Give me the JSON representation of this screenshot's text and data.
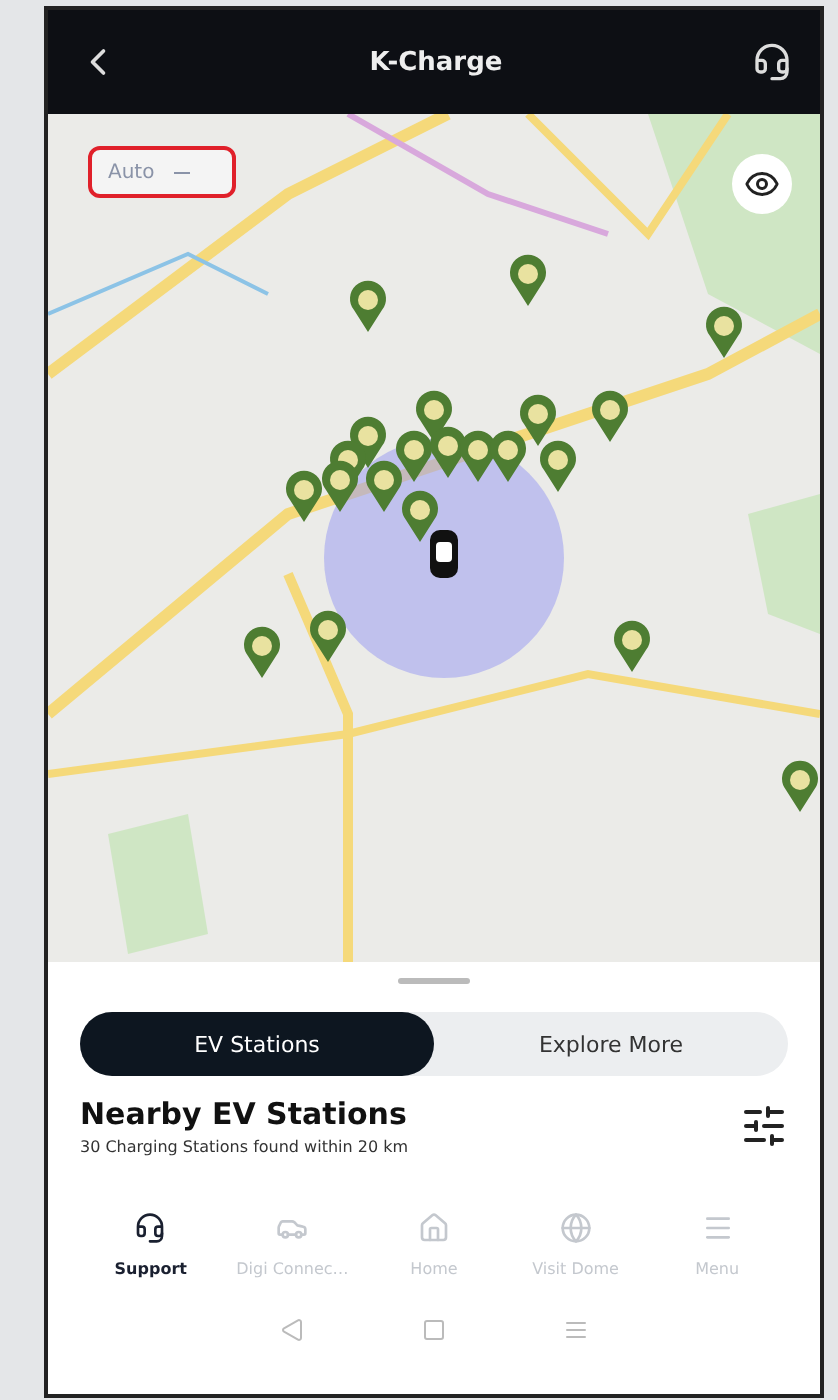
{
  "header": {
    "title": "K-Charge"
  },
  "map": {
    "kind": "picture",
    "mode_dropdown": {
      "value": "Auto",
      "highlighted": true
    }
  },
  "segments": [
    {
      "label": "EV Stations",
      "selected": true
    },
    {
      "label": "Explore More",
      "selected": false
    }
  ],
  "nearby": {
    "title": "Nearby EV Stations",
    "subtitle": "30 Charging Stations found within 20 km"
  },
  "tabs": [
    {
      "label": "Support",
      "selected": true
    },
    {
      "label": "Digi Connec…",
      "selected": false
    },
    {
      "label": "Home",
      "selected": false
    },
    {
      "label": "Visit Dome",
      "selected": false
    },
    {
      "label": "Menu",
      "selected": false
    }
  ]
}
